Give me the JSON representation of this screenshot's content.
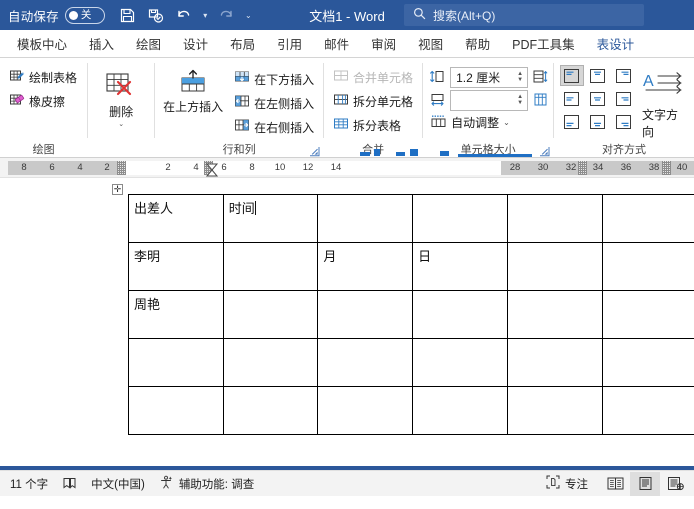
{
  "titlebar": {
    "autosave_label": "自动保存",
    "autosave_state": "关",
    "document_title": "文档1  -  Word",
    "quick_access": [
      {
        "name": "save-icon",
        "tooltip": "保存"
      },
      {
        "name": "save-as-check-icon",
        "tooltip": "另存为"
      },
      {
        "name": "undo-icon",
        "tooltip": "撤消"
      },
      {
        "name": "redo-icon",
        "tooltip": "恢复"
      },
      {
        "name": "customize-qat-icon",
        "tooltip": "自定义快速访问工具栏"
      }
    ],
    "search_placeholder": "搜索(Alt+Q)",
    "accent_color": "#2b579a",
    "search_field_color": "#3c65a4"
  },
  "tabs": [
    {
      "label": "模板中心",
      "active": false
    },
    {
      "label": "插入",
      "active": false
    },
    {
      "label": "绘图",
      "active": false
    },
    {
      "label": "设计",
      "active": false
    },
    {
      "label": "布局",
      "active": false
    },
    {
      "label": "引用",
      "active": false
    },
    {
      "label": "邮件",
      "active": false
    },
    {
      "label": "审阅",
      "active": false
    },
    {
      "label": "视图",
      "active": false
    },
    {
      "label": "帮助",
      "active": false
    },
    {
      "label": "PDF工具集",
      "active": false
    },
    {
      "label": "表设计",
      "active": true
    }
  ],
  "ribbon": {
    "groups": [
      {
        "name": "draw",
        "label": "绘图",
        "items": [
          {
            "label": "绘制表格",
            "icon": "draw-table-icon",
            "disabled": false
          },
          {
            "label": "橡皮擦",
            "icon": "eraser-icon",
            "disabled": false
          }
        ]
      },
      {
        "name": "delete",
        "label": "",
        "items": [
          {
            "label": "删除",
            "icon": "delete-table-icon",
            "disabled": false
          }
        ]
      },
      {
        "name": "rows-and-columns",
        "label": "行和列",
        "items": [
          {
            "label": "在上方插入",
            "icon": "insert-above-icon",
            "disabled": false
          },
          {
            "label": "在下方插入",
            "icon": "insert-below-icon",
            "disabled": false
          },
          {
            "label": "在左侧插入",
            "icon": "insert-left-icon",
            "disabled": false
          },
          {
            "label": "在右侧插入",
            "icon": "insert-right-icon",
            "disabled": false
          }
        ]
      },
      {
        "name": "merge",
        "label": "合并",
        "items": [
          {
            "label": "合并单元格",
            "icon": "merge-cells-icon",
            "disabled": true
          },
          {
            "label": "拆分单元格",
            "icon": "split-cells-icon",
            "disabled": false
          },
          {
            "label": "拆分表格",
            "icon": "split-table-icon",
            "disabled": false
          }
        ]
      },
      {
        "name": "cell-size",
        "label": "单元格大小",
        "height_value": "1.2 厘米",
        "width_value": "",
        "autofit_label": "自动调整",
        "distribute_rows_icon": "distribute-rows-icon",
        "distribute_cols_icon": "distribute-columns-icon"
      },
      {
        "name": "alignment",
        "label": "对齐方式",
        "selected_index": 0,
        "text_direction_label": "文字方向"
      }
    ]
  },
  "ruler": {
    "left_numbers": [
      "8",
      "6",
      "4",
      "2"
    ],
    "right_numbers": [
      "2",
      "4",
      "6",
      "8",
      "10",
      "12",
      "14"
    ],
    "far_right_numbers": [
      "28",
      "30",
      "32",
      "34",
      "36",
      "38",
      "40"
    ]
  },
  "document": {
    "table_move_handle": "✛",
    "cursor_cell": {
      "row": 0,
      "col": 1
    },
    "columns": 7,
    "rows": 5,
    "cells": [
      [
        "出差人",
        "时间",
        "",
        "",
        "",
        "",
        ""
      ],
      [
        "李明",
        "",
        "月",
        "日",
        "",
        "",
        ""
      ],
      [
        "周艳",
        "",
        "",
        "",
        "",
        "",
        ""
      ],
      [
        "",
        "",
        "",
        "",
        "",
        "",
        ""
      ],
      [
        "",
        "",
        "",
        "",
        "",
        "",
        ""
      ]
    ]
  },
  "statusbar": {
    "word_count": "11 个字",
    "proofing_icon": "proofing-icon",
    "language": "中文(中国)",
    "accessibility": "辅助功能: 调查",
    "focus_label": "专注",
    "views": [
      {
        "name": "read-mode-icon",
        "active": false
      },
      {
        "name": "print-layout-icon",
        "active": true
      },
      {
        "name": "web-layout-icon",
        "active": false
      }
    ]
  }
}
